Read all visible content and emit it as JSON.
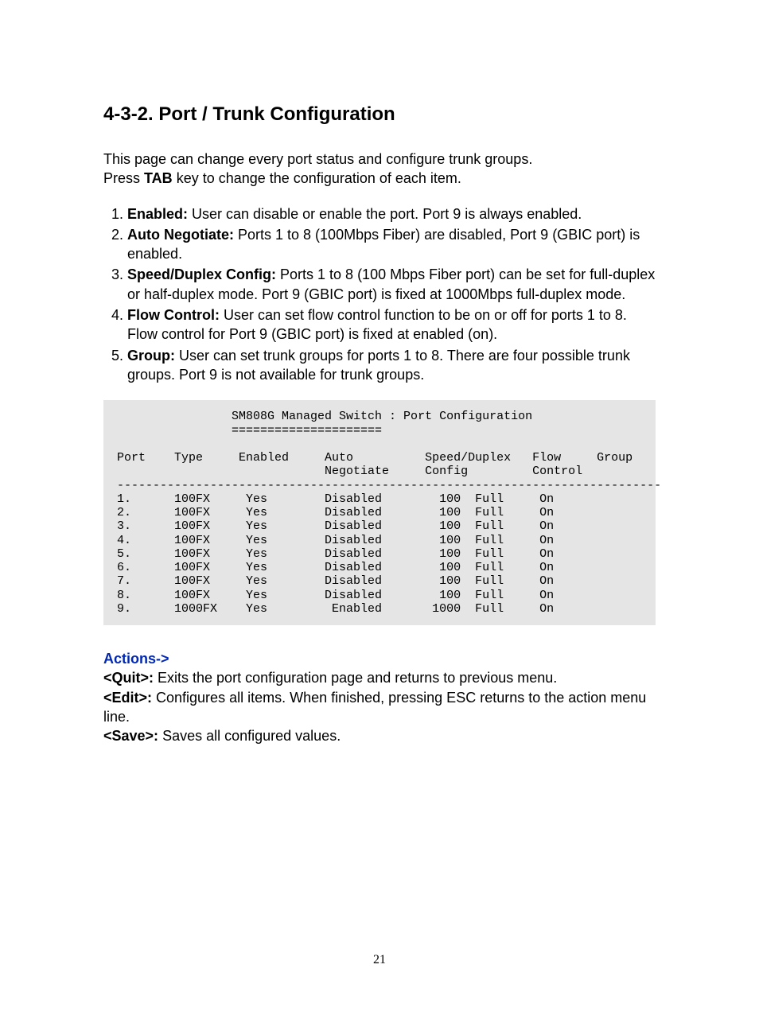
{
  "heading": "4-3-2. Port / Trunk Configuration",
  "intro_line1": "This page can change every port status and configure trunk groups.",
  "intro_line2_a": "Press ",
  "intro_line2_b": "TAB",
  "intro_line2_c": " key to change the configuration of each item.",
  "items": [
    {
      "label": "Enabled:",
      "text": " User can disable or enable the port. Port 9 is always enabled."
    },
    {
      "label": "Auto Negotiate:",
      "text": " Ports 1 to 8 (100Mbps Fiber) are disabled, Port 9 (GBIC port) is enabled."
    },
    {
      "label": "Speed/Duplex Config:",
      "text": " Ports 1 to 8 (100 Mbps Fiber port) can be set for full-duplex or half-duplex mode. Port 9 (GBIC port) is fixed at 1000Mbps full-duplex mode."
    },
    {
      "label": "Flow Control:",
      "text": " User can set flow control function to be on or off for ports 1 to 8. Flow control for Port 9 (GBIC port) is fixed at enabled (on)."
    },
    {
      "label": "Group:",
      "text": " User can set trunk groups for ports 1 to 8. There are four possible trunk groups. Port 9 is not available for trunk groups."
    }
  ],
  "terminal": {
    "title": "                 SM808G Managed Switch : Port Configuration",
    "divider": "                 =====================",
    "header1": " Port    Type     Enabled     Auto          Speed/Duplex   Flow     Group",
    "header2": "                              Negotiate     Config         Control",
    "sep": " ----------------------------------------------------------------------------",
    "rows": [
      " 1.      100FX     Yes        Disabled        100  Full     On",
      " 2.      100FX     Yes        Disabled        100  Full     On",
      " 3.      100FX     Yes        Disabled        100  Full     On",
      " 4.      100FX     Yes        Disabled        100  Full     On",
      " 5.      100FX     Yes        Disabled        100  Full     On",
      " 6.      100FX     Yes        Disabled        100  Full     On",
      " 7.      100FX     Yes        Disabled        100  Full     On",
      " 8.      100FX     Yes        Disabled        100  Full     On",
      " 9.      1000FX    Yes         Enabled       1000  Full     On"
    ]
  },
  "actions_heading": "Actions->",
  "actions": [
    {
      "label": "<Quit>:",
      "text": " Exits the port configuration page and returns to previous menu."
    },
    {
      "label": "<Edit>:",
      "text": " Configures all items. When finished, pressing ESC returns to the action menu line."
    },
    {
      "label": "<Save>:",
      "text": " Saves all configured values."
    }
  ],
  "page_number": "21"
}
